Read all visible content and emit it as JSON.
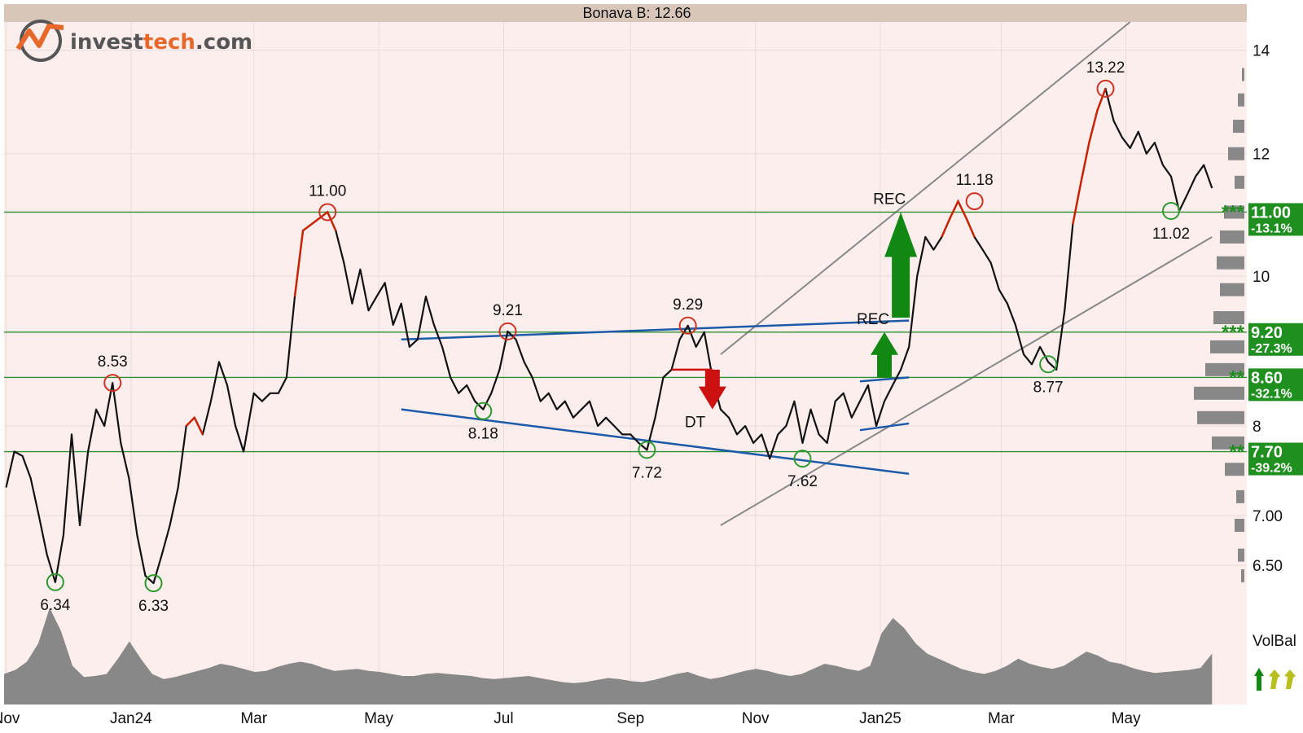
{
  "colors": {
    "plot_bg": "#fdeeee",
    "header_bg": "#d8c6bb",
    "price_line": "#111111",
    "price_overbought": "#cc2200",
    "support_green": "#2f8f2f",
    "trend_blue": "#1a5aa8",
    "channel_gray": "#888888",
    "volume_fill": "#888888",
    "peak_circle": "#cc3322",
    "trough_circle": "#2e9a2e",
    "buy_arrow": "#118811",
    "sell_arrow": "#cc1111",
    "level_box": "#1f8f1f"
  },
  "brand": {
    "logo_text_main": "invest",
    "logo_text_accent": "tech",
    "logo_text_suffix": ".com"
  },
  "chart_data": {
    "type": "line",
    "title": "Bonava B: 12.66",
    "xlabel": "",
    "ylabel": "",
    "ylim": [
      6.3,
      14.6
    ],
    "scale": "log",
    "x_tick_labels": [
      "Nov",
      "Jan24",
      "Mar",
      "May",
      "Jul",
      "Sep",
      "Nov",
      "Jan25",
      "Mar",
      "May"
    ],
    "x_ticks": [
      "2023-11-01",
      "2024-01-01",
      "2024-03-01",
      "2024-05-01",
      "2024-07-01",
      "2024-09-01",
      "2024-11-01",
      "2025-01-01",
      "2025-03-01",
      "2025-05-01"
    ],
    "y_ticks": [
      {
        "value": 14,
        "label": "14"
      },
      {
        "value": 12,
        "label": "12"
      },
      {
        "value": 10,
        "label": "10"
      },
      {
        "value": 8,
        "label": "8"
      },
      {
        "value": 7,
        "label": "7.00"
      },
      {
        "value": 6.5,
        "label": "6.50"
      }
    ],
    "x_range": [
      "2023-10-31",
      "2025-06-29"
    ],
    "grid": true,
    "price_series": {
      "x": [
        "2023-11-01",
        "2023-11-05",
        "2023-11-09",
        "2023-11-13",
        "2023-11-17",
        "2023-11-21",
        "2023-11-25",
        "2023-11-29",
        "2023-12-03",
        "2023-12-07",
        "2023-12-11",
        "2023-12-15",
        "2023-12-19",
        "2023-12-23",
        "2023-12-27",
        "2023-12-31",
        "2024-01-04",
        "2024-01-08",
        "2024-01-12",
        "2024-01-16",
        "2024-01-20",
        "2024-01-24",
        "2024-01-28",
        "2024-02-01",
        "2024-02-05",
        "2024-02-09",
        "2024-02-13",
        "2024-02-17",
        "2024-02-21",
        "2024-02-25",
        "2024-03-01",
        "2024-03-05",
        "2024-03-09",
        "2024-03-13",
        "2024-03-17",
        "2024-03-21",
        "2024-03-25",
        "2024-03-29",
        "2024-04-02",
        "2024-04-06",
        "2024-04-10",
        "2024-04-14",
        "2024-04-18",
        "2024-04-22",
        "2024-04-26",
        "2024-04-30",
        "2024-05-04",
        "2024-05-08",
        "2024-05-12",
        "2024-05-16",
        "2024-05-20",
        "2024-05-24",
        "2024-05-28",
        "2024-06-01",
        "2024-06-05",
        "2024-06-09",
        "2024-06-13",
        "2024-06-17",
        "2024-06-21",
        "2024-06-25",
        "2024-06-29",
        "2024-07-03",
        "2024-07-07",
        "2024-07-11",
        "2024-07-15",
        "2024-07-19",
        "2024-07-23",
        "2024-07-27",
        "2024-07-31",
        "2024-08-04",
        "2024-08-08",
        "2024-08-12",
        "2024-08-16",
        "2024-08-20",
        "2024-08-24",
        "2024-08-28",
        "2024-09-01",
        "2024-09-05",
        "2024-09-09",
        "2024-09-13",
        "2024-09-17",
        "2024-09-21",
        "2024-09-25",
        "2024-09-29",
        "2024-10-03",
        "2024-10-07",
        "2024-10-11",
        "2024-10-15",
        "2024-10-19",
        "2024-10-23",
        "2024-10-27",
        "2024-10-31",
        "2024-11-04",
        "2024-11-08",
        "2024-11-12",
        "2024-11-16",
        "2024-11-20",
        "2024-11-24",
        "2024-11-28",
        "2024-12-02",
        "2024-12-06",
        "2024-12-10",
        "2024-12-14",
        "2024-12-18",
        "2024-12-22",
        "2024-12-26",
        "2024-12-30",
        "2025-01-03",
        "2025-01-07",
        "2025-01-11",
        "2025-01-15",
        "2025-01-19",
        "2025-01-23",
        "2025-01-27",
        "2025-01-31",
        "2025-02-04",
        "2025-02-08",
        "2025-02-12",
        "2025-02-16",
        "2025-02-20",
        "2025-02-24",
        "2025-02-28",
        "2025-03-04",
        "2025-03-08",
        "2025-03-12",
        "2025-03-16",
        "2025-03-20",
        "2025-03-24",
        "2025-03-28",
        "2025-04-01",
        "2025-04-05",
        "2025-04-09",
        "2025-04-13",
        "2025-04-17",
        "2025-04-21",
        "2025-04-25",
        "2025-04-29",
        "2025-05-03",
        "2025-05-07",
        "2025-05-11",
        "2025-05-15",
        "2025-05-19",
        "2025-05-23",
        "2025-05-27",
        "2025-05-31",
        "2025-06-04",
        "2025-06-08",
        "2025-06-12"
      ],
      "values": [
        7.3,
        7.7,
        7.65,
        7.4,
        7.0,
        6.6,
        6.34,
        6.8,
        7.9,
        6.9,
        7.7,
        8.2,
        8.0,
        8.53,
        7.8,
        7.4,
        6.8,
        6.4,
        6.33,
        6.6,
        6.9,
        7.3,
        8.0,
        8.1,
        7.9,
        8.3,
        8.8,
        8.5,
        8.0,
        7.7,
        8.4,
        8.3,
        8.4,
        8.4,
        8.6,
        9.7,
        10.7,
        10.8,
        10.9,
        11.0,
        10.7,
        10.2,
        9.6,
        10.1,
        9.5,
        9.7,
        9.9,
        9.3,
        9.6,
        9.0,
        9.1,
        9.7,
        9.3,
        9.0,
        8.6,
        8.4,
        8.5,
        8.3,
        8.2,
        8.4,
        8.7,
        9.21,
        9.1,
        8.8,
        8.6,
        8.3,
        8.4,
        8.2,
        8.3,
        8.1,
        8.2,
        8.3,
        8.0,
        8.1,
        8.0,
        7.9,
        7.9,
        7.8,
        7.72,
        8.1,
        8.6,
        8.7,
        9.1,
        9.29,
        9.0,
        9.2,
        8.6,
        8.2,
        8.1,
        7.9,
        8.0,
        7.8,
        7.9,
        7.62,
        7.9,
        8.0,
        8.3,
        7.8,
        8.2,
        7.9,
        7.8,
        8.3,
        8.4,
        8.1,
        8.3,
        8.5,
        8.0,
        8.3,
        8.5,
        8.7,
        9.0,
        10.0,
        10.6,
        10.4,
        10.6,
        10.9,
        11.18,
        10.9,
        10.6,
        10.4,
        10.2,
        9.8,
        9.6,
        9.3,
        8.9,
        8.77,
        9.0,
        8.8,
        8.7,
        9.5,
        10.8,
        11.5,
        12.2,
        12.8,
        13.22,
        12.6,
        12.3,
        12.1,
        12.4,
        12.0,
        12.2,
        11.8,
        11.6,
        11.02,
        11.3,
        11.6,
        11.8,
        11.4,
        12.66
      ]
    },
    "overbought_segments": [
      {
        "from": "2024-03-21",
        "to": "2024-04-10"
      },
      {
        "from": "2024-01-28",
        "to": "2024-02-05"
      },
      {
        "from": "2025-01-31",
        "to": "2025-02-16"
      },
      {
        "from": "2025-04-05",
        "to": "2025-04-21"
      }
    ],
    "pivots": [
      {
        "kind": "peak",
        "x": "2023-12-23",
        "value": 8.53,
        "label": "8.53"
      },
      {
        "kind": "trough",
        "x": "2023-11-25",
        "value": 6.34,
        "label": "6.34"
      },
      {
        "kind": "trough",
        "x": "2024-01-12",
        "value": 6.33,
        "label": "6.33"
      },
      {
        "kind": "peak",
        "x": "2024-04-06",
        "value": 11.0,
        "label": "11.00"
      },
      {
        "kind": "trough",
        "x": "2024-06-21",
        "value": 8.18,
        "label": "8.18"
      },
      {
        "kind": "peak",
        "x": "2024-07-03",
        "value": 9.21,
        "label": "9.21"
      },
      {
        "kind": "trough",
        "x": "2024-09-09",
        "value": 7.72,
        "label": "7.72"
      },
      {
        "kind": "peak",
        "x": "2024-09-29",
        "value": 9.29,
        "label": "9.29"
      },
      {
        "kind": "trough",
        "x": "2024-11-24",
        "value": 7.62,
        "label": "7.62"
      },
      {
        "kind": "peak",
        "x": "2025-02-16",
        "value": 11.18,
        "label": "11.18"
      },
      {
        "kind": "trough",
        "x": "2025-03-24",
        "value": 8.77,
        "label": "8.77"
      },
      {
        "kind": "peak",
        "x": "2025-04-21",
        "value": 13.22,
        "label": "13.22"
      },
      {
        "kind": "trough",
        "x": "2025-05-23",
        "value": 11.02,
        "label": "11.02"
      }
    ],
    "support_levels": [
      {
        "value": 11.0,
        "label": "11.00",
        "pct": "-13.1%",
        "stars": "***"
      },
      {
        "value": 9.2,
        "label": "9.20",
        "pct": "-27.3%",
        "stars": "***"
      },
      {
        "value": 8.6,
        "label": "8.60",
        "pct": "-32.1%",
        "stars": "**"
      },
      {
        "value": 7.7,
        "label": "7.70",
        "pct": "-39.2%",
        "stars": "**"
      }
    ],
    "trend_lines": [
      {
        "style": "blue",
        "from": [
          "2024-05-12",
          9.1
        ],
        "to": [
          "2025-01-15",
          9.36
        ]
      },
      {
        "style": "blue",
        "from": [
          "2024-05-12",
          8.2
        ],
        "to": [
          "2025-01-15",
          7.45
        ]
      },
      {
        "style": "blue",
        "from": [
          "2024-12-22",
          8.55
        ],
        "to": [
          "2025-01-15",
          8.6
        ]
      },
      {
        "style": "blue",
        "from": [
          "2024-12-22",
          7.95
        ],
        "to": [
          "2025-01-15",
          8.03
        ]
      },
      {
        "style": "gray",
        "from": [
          "2024-10-15",
          8.9
        ],
        "to": [
          "2025-05-03",
          14.6
        ]
      },
      {
        "style": "gray",
        "from": [
          "2024-10-15",
          6.9
        ],
        "to": [
          "2025-06-12",
          10.6
        ]
      }
    ],
    "signals": [
      {
        "kind": "buy",
        "label": "REC",
        "x": "2025-01-11",
        "value_low": 9.4,
        "value_high": 11.0,
        "size": "large"
      },
      {
        "kind": "buy",
        "label": "REC",
        "x": "2025-01-03",
        "value_low": 8.6,
        "value_high": 9.2,
        "size": "small"
      },
      {
        "kind": "sell",
        "label": "DT",
        "x": "2024-10-11",
        "value_low": 8.2,
        "value_high": 8.7,
        "size": "small"
      }
    ],
    "volume_profile": [
      {
        "value": 13.5,
        "width": 3
      },
      {
        "value": 13.0,
        "width": 8
      },
      {
        "value": 12.5,
        "width": 14
      },
      {
        "value": 12.0,
        "width": 20
      },
      {
        "value": 11.5,
        "width": 12
      },
      {
        "value": 11.0,
        "width": 25
      },
      {
        "value": 10.6,
        "width": 30
      },
      {
        "value": 10.2,
        "width": 34
      },
      {
        "value": 9.8,
        "width": 30
      },
      {
        "value": 9.4,
        "width": 38
      },
      {
        "value": 9.0,
        "width": 42
      },
      {
        "value": 8.7,
        "width": 48
      },
      {
        "value": 8.4,
        "width": 62
      },
      {
        "value": 8.1,
        "width": 58
      },
      {
        "value": 7.8,
        "width": 40
      },
      {
        "value": 7.5,
        "width": 24
      },
      {
        "value": 7.2,
        "width": 10
      },
      {
        "value": 6.9,
        "width": 12
      },
      {
        "value": 6.6,
        "width": 8
      },
      {
        "value": 6.4,
        "width": 4
      }
    ],
    "volume_series": [
      0.3,
      0.34,
      0.42,
      0.6,
      0.95,
      0.72,
      0.38,
      0.27,
      0.28,
      0.3,
      0.45,
      0.62,
      0.45,
      0.3,
      0.25,
      0.27,
      0.3,
      0.33,
      0.36,
      0.4,
      0.38,
      0.35,
      0.32,
      0.33,
      0.37,
      0.4,
      0.42,
      0.4,
      0.36,
      0.33,
      0.34,
      0.35,
      0.33,
      0.32,
      0.3,
      0.28,
      0.28,
      0.3,
      0.31,
      0.3,
      0.29,
      0.28,
      0.26,
      0.25,
      0.26,
      0.27,
      0.28,
      0.26,
      0.24,
      0.22,
      0.21,
      0.22,
      0.24,
      0.26,
      0.25,
      0.23,
      0.22,
      0.24,
      0.27,
      0.3,
      0.32,
      0.28,
      0.25,
      0.27,
      0.3,
      0.33,
      0.35,
      0.33,
      0.3,
      0.28,
      0.3,
      0.35,
      0.4,
      0.38,
      0.35,
      0.33,
      0.38,
      0.7,
      0.85,
      0.75,
      0.6,
      0.5,
      0.45,
      0.4,
      0.35,
      0.32,
      0.3,
      0.33,
      0.38,
      0.45,
      0.4,
      0.37,
      0.35,
      0.38,
      0.45,
      0.52,
      0.48,
      0.42,
      0.4,
      0.36,
      0.33,
      0.31,
      0.32,
      0.33,
      0.34,
      0.36,
      0.5
    ],
    "volume_label": "VolBal"
  }
}
